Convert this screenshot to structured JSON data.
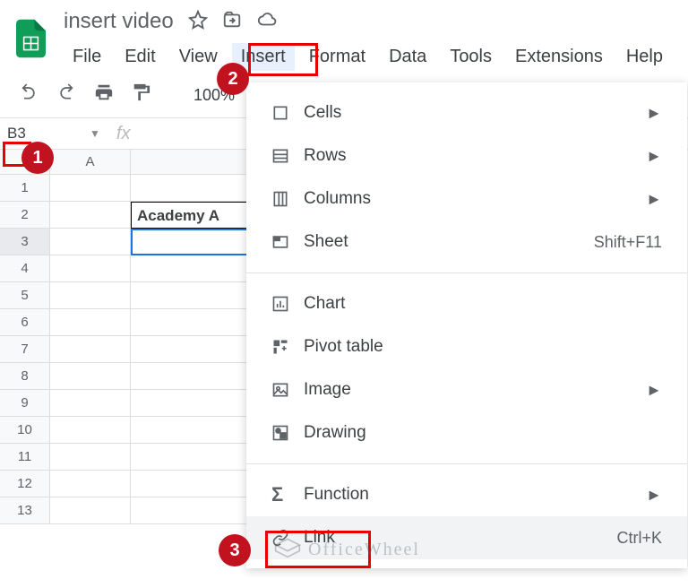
{
  "header": {
    "doc_title": "insert video"
  },
  "menubar": {
    "file": "File",
    "edit": "Edit",
    "view": "View",
    "insert": "Insert",
    "format": "Format",
    "data": "Data",
    "tools": "Tools",
    "extensions": "Extensions",
    "help": "Help"
  },
  "toolbar": {
    "zoom": "100%"
  },
  "namebox": {
    "cell_ref": "B3",
    "fx_label": "fx"
  },
  "columns": {
    "a": "A"
  },
  "rows": [
    "1",
    "2",
    "3",
    "4",
    "5",
    "6",
    "7",
    "8",
    "9",
    "10",
    "11",
    "12",
    "13"
  ],
  "cells": {
    "b2": "Academy A"
  },
  "insert_menu": {
    "cells": "Cells",
    "rows": "Rows",
    "columns": "Columns",
    "sheet": "Sheet",
    "sheet_shortcut": "Shift+F11",
    "chart": "Chart",
    "pivot": "Pivot table",
    "image": "Image",
    "drawing": "Drawing",
    "function": "Function",
    "link": "Link",
    "link_shortcut": "Ctrl+K",
    "arrow": "►"
  },
  "annotations": {
    "n1": "1",
    "n2": "2",
    "n3": "3"
  },
  "watermark": "OfficeWheel"
}
